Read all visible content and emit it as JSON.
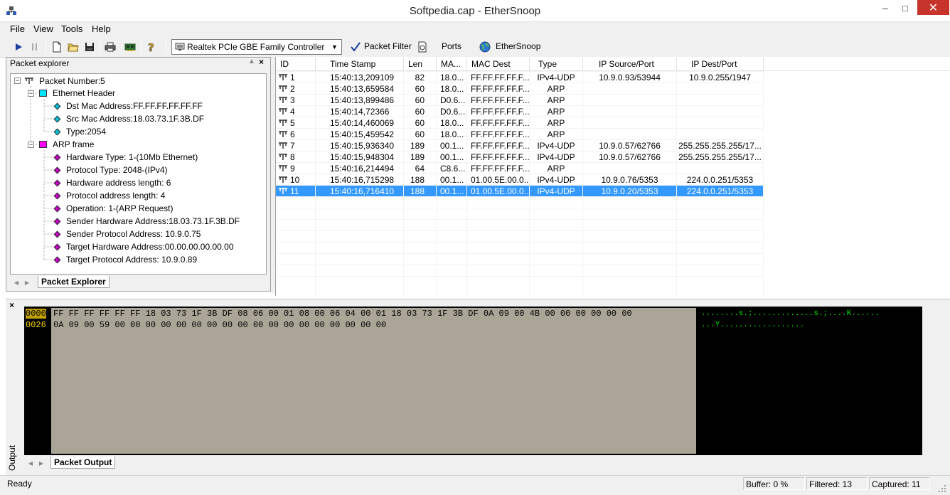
{
  "window": {
    "title": "Softpedia.cap - EtherSnoop",
    "minimize": "–",
    "maximize": "□",
    "close": "✕"
  },
  "menu": [
    "File",
    "View",
    "Tools",
    "Help"
  ],
  "toolbar": {
    "adapter": "Realtek PCIe GBE Family Controller",
    "packet_filter": "Packet Filter",
    "ports": "Ports",
    "ethersnoop": "EtherSnoop"
  },
  "packet_explorer": {
    "title": "Packet explorer",
    "pin": "▲",
    "close": "×",
    "tab": "Packet Explorer",
    "root": "Packet Number:5",
    "ethernet": {
      "label": "Ethernet Header",
      "items": [
        "Dst Mac Address:FF.FF.FF.FF.FF.FF",
        "Src Mac Address:18.03.73.1F.3B.DF",
        "Type:2054"
      ]
    },
    "arp": {
      "label": "ARP frame",
      "items": [
        "Hardware Type: 1-(10Mb Ethernet)",
        "Protocol Type: 2048-(IPv4)",
        "Hardware address length: 6",
        "Protocol address length: 4",
        "Operation: 1-(ARP Request)",
        "Sender Hardware Address:18.03.73.1F.3B.DF",
        "Sender Protocol Address: 10.9.0.75",
        "Target Hardware Address:00.00.00.00.00.00",
        "Target Protocol Address: 10.9.0.89"
      ]
    }
  },
  "packet_list": {
    "columns": [
      "ID",
      "Time Stamp",
      "Len",
      "MA...",
      "MAC Dest",
      "Type",
      "IP Source/Port",
      "IP Dest/Port"
    ],
    "rows": [
      [
        "1",
        "15:40:13,209109",
        "82",
        "18.0...",
        "FF.FF.FF.FF.F...",
        "IPv4-UDP",
        "10.9.0.93/53944",
        "10.9.0.255/1947"
      ],
      [
        "2",
        "15:40:13,659584",
        "60",
        "18.0...",
        "FF.FF.FF.FF.F...",
        "ARP",
        "",
        ""
      ],
      [
        "3",
        "15:40:13,899486",
        "60",
        "D0.6...",
        "FF.FF.FF.FF.F...",
        "ARP",
        "",
        ""
      ],
      [
        "4",
        "15:40:14,72366",
        "60",
        "D0.6...",
        "FF.FF.FF.FF.F...",
        "ARP",
        "",
        ""
      ],
      [
        "5",
        "15:40:14,460069",
        "60",
        "18.0...",
        "FF.FF.FF.FF.F...",
        "ARP",
        "",
        ""
      ],
      [
        "6",
        "15:40:15,459542",
        "60",
        "18.0...",
        "FF.FF.FF.FF.F...",
        "ARP",
        "",
        ""
      ],
      [
        "7",
        "15:40:15,936340",
        "189",
        "00.1...",
        "FF.FF.FF.FF.F...",
        "IPv4-UDP",
        "10.9.0.57/62766",
        "255.255.255.255/17..."
      ],
      [
        "8",
        "15:40:15,948304",
        "189",
        "00.1...",
        "FF.FF.FF.FF.F...",
        "IPv4-UDP",
        "10.9.0.57/62766",
        "255.255.255.255/17..."
      ],
      [
        "9",
        "15:40:16,214494",
        "64",
        "C8.6...",
        "FF.FF.FF.FF.F...",
        "ARP",
        "",
        ""
      ],
      [
        "10",
        "15:40:16,715298",
        "188",
        "00.1...",
        "01.00.5E.00.0...",
        "IPv4-UDP",
        "10.9.0.76/5353",
        "224.0.0.251/5353"
      ],
      [
        "11",
        "15:40:16,716410",
        "188",
        "00.1...",
        "01.00.5E.00.0...",
        "IPv4-UDP",
        "10.9.0.20/5353",
        "224.0.0.251/5353"
      ]
    ],
    "selected_index": 10
  },
  "output": {
    "title": "Output",
    "close": "×",
    "tab": "Packet Output",
    "offsets": [
      "0000",
      "0026"
    ],
    "hex": [
      "FF FF FF FF FF FF 18 03 73 1F 3B DF 08 06 00 01 08 00 06 04 00 01 18 03 73 1F 3B DF 0A 09 00 4B 00 00 00 00 00 00",
      "0A 09 00 59 00 00 00 00 00 00 00 00 00 00 00 00 00 00 00 00 00 00"
    ],
    "ascii": [
      "........s.;.............s.;....K......",
      "...Y.................."
    ]
  },
  "status": {
    "ready": "Ready",
    "buffer": "Buffer: 0 %",
    "filtered": "Filtered: 13",
    "captured": "Captured: 11"
  }
}
